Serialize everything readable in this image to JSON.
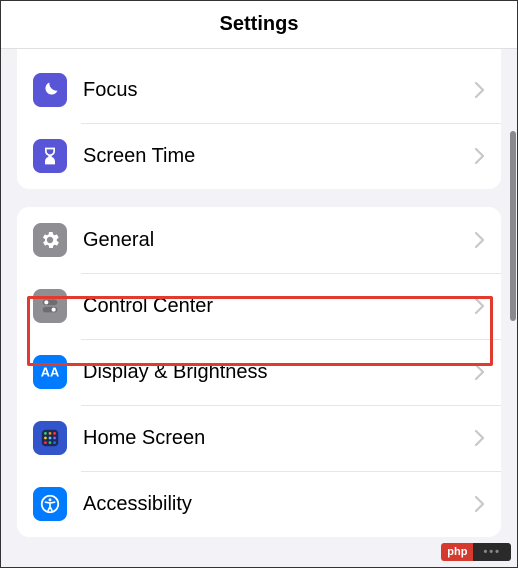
{
  "header": {
    "title": "Settings"
  },
  "group1": {
    "items": [
      {
        "label": "Focus",
        "icon": "focus-icon",
        "bg": "#5856d6"
      },
      {
        "label": "Screen Time",
        "icon": "screentime-icon",
        "bg": "#5856d6"
      }
    ]
  },
  "group2": {
    "items": [
      {
        "label": "General",
        "icon": "general-icon",
        "bg": "#8e8e93"
      },
      {
        "label": "Control Center",
        "icon": "controlcenter-icon",
        "bg": "#8e8e93",
        "highlighted": true
      },
      {
        "label": "Display & Brightness",
        "icon": "display-icon",
        "bg": "#007aff"
      },
      {
        "label": "Home Screen",
        "icon": "homescreen-icon",
        "bg": "#3355cc"
      },
      {
        "label": "Accessibility",
        "icon": "accessibility-icon",
        "bg": "#007aff"
      }
    ]
  },
  "watermark": {
    "left": "php",
    "right": "•••"
  }
}
